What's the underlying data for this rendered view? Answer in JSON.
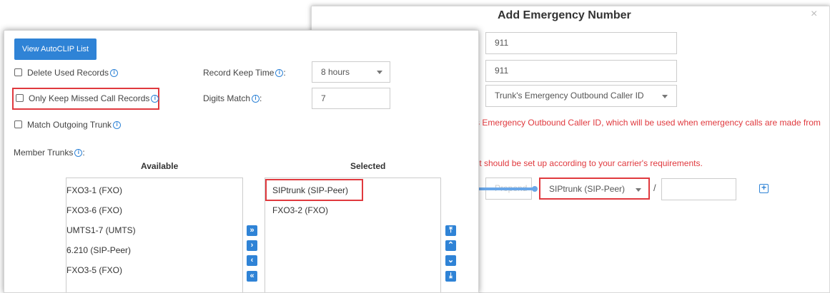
{
  "dialog": {
    "title": "Add Emergency Number",
    "close_glyph": "×",
    "field1_value": "911",
    "field2_value": "911",
    "caller_id_select": "Trunk's Emergency Outbound Caller ID",
    "note_caller_id": "s Emergency Outbound Caller ID, which will be used when emergency calls are made from",
    "note_carrier": "It should be set up according to your carrier's requirements.",
    "prepend_placeholder": "Prepend",
    "trunk_select": "SIPtrunk (SIP-Peer)",
    "separator": "/",
    "add_glyph": "+"
  },
  "panel": {
    "view_autoclip_button": "View AutoCLIP List",
    "delete_used_records": "Delete Used Records",
    "only_keep_missed": "Only Keep Missed Call Records",
    "match_outgoing_trunk": "Match Outgoing Trunk",
    "record_keep_time_label": "Record Keep Time",
    "record_keep_time_value": "8 hours",
    "digits_match_label": "Digits Match",
    "digits_match_value": "7",
    "label_colon": ":",
    "member_trunks_label": "Member Trunks",
    "available_header": "Available",
    "selected_header": "Selected",
    "available": [
      "FXO3-1 (FXO)",
      "FXO3-6 (FXO)",
      "UMTS1-7 (UMTS)",
      "6.210 (SIP-Peer)",
      "FXO3-5 (FXO)"
    ],
    "selected": [
      "SIPtrunk (SIP-Peer)",
      "FXO3-2 (FXO)"
    ],
    "move_buttons": [
      "»",
      "›",
      "‹",
      "«"
    ],
    "order_buttons": [
      "⤒",
      "⌃",
      "⌄",
      "⤓"
    ],
    "info_glyph": "i"
  },
  "colors": {
    "accent": "#2f83d6",
    "highlight": "#e0393e",
    "connector": "#6aa7e8"
  }
}
